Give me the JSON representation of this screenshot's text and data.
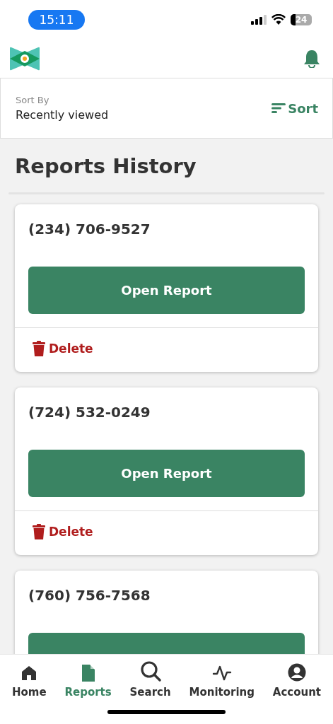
{
  "status_bar": {
    "time": "15:11",
    "battery": "24"
  },
  "sort": {
    "label": "Sort By",
    "value": "Recently viewed",
    "button": "Sort"
  },
  "title": "Reports History",
  "reports": [
    {
      "phone": "(234) 706-9527",
      "open_label": "Open Report",
      "delete_label": "Delete"
    },
    {
      "phone": "(724) 532-0249",
      "open_label": "Open Report",
      "delete_label": "Delete"
    },
    {
      "phone": "(760) 756-7568"
    }
  ],
  "tabs": [
    {
      "kind": "home",
      "label": "Home",
      "selected": false
    },
    {
      "kind": "reports",
      "label": "Reports",
      "selected": true
    },
    {
      "kind": "search",
      "label": "Search",
      "selected": false
    },
    {
      "kind": "monitoring",
      "label": "Monitoring",
      "selected": false
    },
    {
      "kind": "account",
      "label": "Account",
      "selected": false
    }
  ]
}
